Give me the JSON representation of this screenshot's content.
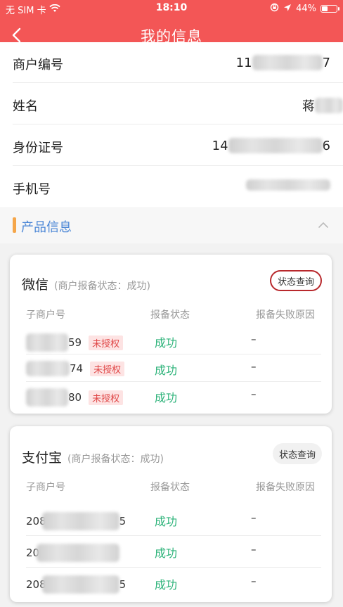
{
  "status_bar": {
    "carrier": "无 SIM 卡",
    "time": "18:10",
    "battery": "44%",
    "battery_level": 0.44
  },
  "nav": {
    "title": "我的信息"
  },
  "info_rows": [
    {
      "label": "商户编号",
      "value_prefix": "11",
      "value_suffix": "7"
    },
    {
      "label": "姓名",
      "value_prefix": "蒋",
      "value_suffix": ""
    },
    {
      "label": "身份证号",
      "value_prefix": "14",
      "value_suffix": "6"
    },
    {
      "label": "手机号",
      "value_prefix": "",
      "value_suffix": ""
    }
  ],
  "section": {
    "title": "产品信息"
  },
  "wechat": {
    "name": "微信",
    "status_text": "(商户报备状态：成功)",
    "query_label": "状态查询",
    "columns": [
      "子商户号",
      "报备状态",
      "报备失败原因"
    ],
    "rows": [
      {
        "id_suffix": "59",
        "tag": "未授权",
        "status": "成功",
        "reason": "–"
      },
      {
        "id_suffix": "74",
        "tag": "未授权",
        "status": "成功",
        "reason": "–"
      },
      {
        "id_suffix": "80",
        "tag": "未授权",
        "status": "成功",
        "reason": "–"
      }
    ]
  },
  "alipay": {
    "name": "支付宝",
    "status_text": "(商户报备状态：成功)",
    "query_label": "状态查询",
    "columns": [
      "子商户号",
      "报备状态",
      "报备失败原因"
    ],
    "rows": [
      {
        "id_prefix": "208",
        "id_suffix": "5",
        "status": "成功",
        "reason": "–"
      },
      {
        "id_prefix": "20",
        "id_suffix": "",
        "status": "成功",
        "reason": "–"
      },
      {
        "id_prefix": "208",
        "id_suffix": "5",
        "status": "成功",
        "reason": "–"
      }
    ]
  },
  "colors": {
    "header": "#f35656",
    "accent_bar": "#f5a64a",
    "section_title": "#4a86d6",
    "success": "#2db37a",
    "tag_text": "#e04848",
    "tag_bg": "#fde3e3",
    "highlight_border": "#b8282c"
  }
}
